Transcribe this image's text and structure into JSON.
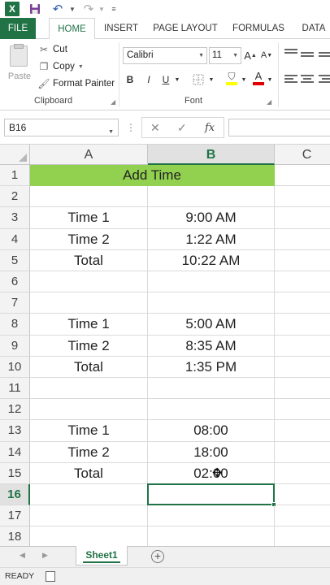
{
  "qat": {
    "app_icon": "X",
    "save": "save-icon",
    "undo": "undo-icon",
    "redo": "redo-icon"
  },
  "ribbon_tabs": [
    "FILE",
    "HOME",
    "INSERT",
    "PAGE LAYOUT",
    "FORMULAS",
    "DATA"
  ],
  "active_tab": "HOME",
  "clipboard": {
    "paste": "Paste",
    "cut": "Cut",
    "copy": "Copy",
    "format_painter": "Format Painter",
    "group_label": "Clipboard"
  },
  "font": {
    "name": "Calibri",
    "size": "11",
    "bold": "B",
    "italic": "I",
    "underline": "U",
    "grow": "A",
    "shrink": "A",
    "font_color": "A",
    "group_label": "Font"
  },
  "formula_bar": {
    "name_box": "B16",
    "cancel": "✕",
    "enter": "✓",
    "fx": "fx",
    "value": ""
  },
  "columns": [
    "A",
    "B",
    "C"
  ],
  "selected_column": "B",
  "rows": [
    {
      "num": "1",
      "a": "Add Time",
      "b": ""
    },
    {
      "num": "2",
      "a": "",
      "b": ""
    },
    {
      "num": "3",
      "a": "Time 1",
      "b": "9:00 AM"
    },
    {
      "num": "4",
      "a": "Time 2",
      "b": "1:22 AM"
    },
    {
      "num": "5",
      "a": "Total",
      "b": "10:22 AM"
    },
    {
      "num": "6",
      "a": "",
      "b": ""
    },
    {
      "num": "7",
      "a": "",
      "b": ""
    },
    {
      "num": "8",
      "a": "Time 1",
      "b": "5:00 AM"
    },
    {
      "num": "9",
      "a": "Time 2",
      "b": "8:35 AM"
    },
    {
      "num": "10",
      "a": "Total",
      "b": "1:35 PM"
    },
    {
      "num": "11",
      "a": "",
      "b": ""
    },
    {
      "num": "12",
      "a": "",
      "b": ""
    },
    {
      "num": "13",
      "a": "Time 1",
      "b": "08:00"
    },
    {
      "num": "14",
      "a": "Time 2",
      "b": "18:00"
    },
    {
      "num": "15",
      "a": "Total",
      "b": "02:00"
    },
    {
      "num": "16",
      "a": "",
      "b": ""
    },
    {
      "num": "17",
      "a": "",
      "b": ""
    },
    {
      "num": "18",
      "a": "",
      "b": ""
    }
  ],
  "selected_cell": "B16",
  "title_fill": "#92d050",
  "accent": "#217346",
  "sheets": [
    "Sheet1"
  ],
  "add_sheet": "+",
  "status": "READY"
}
